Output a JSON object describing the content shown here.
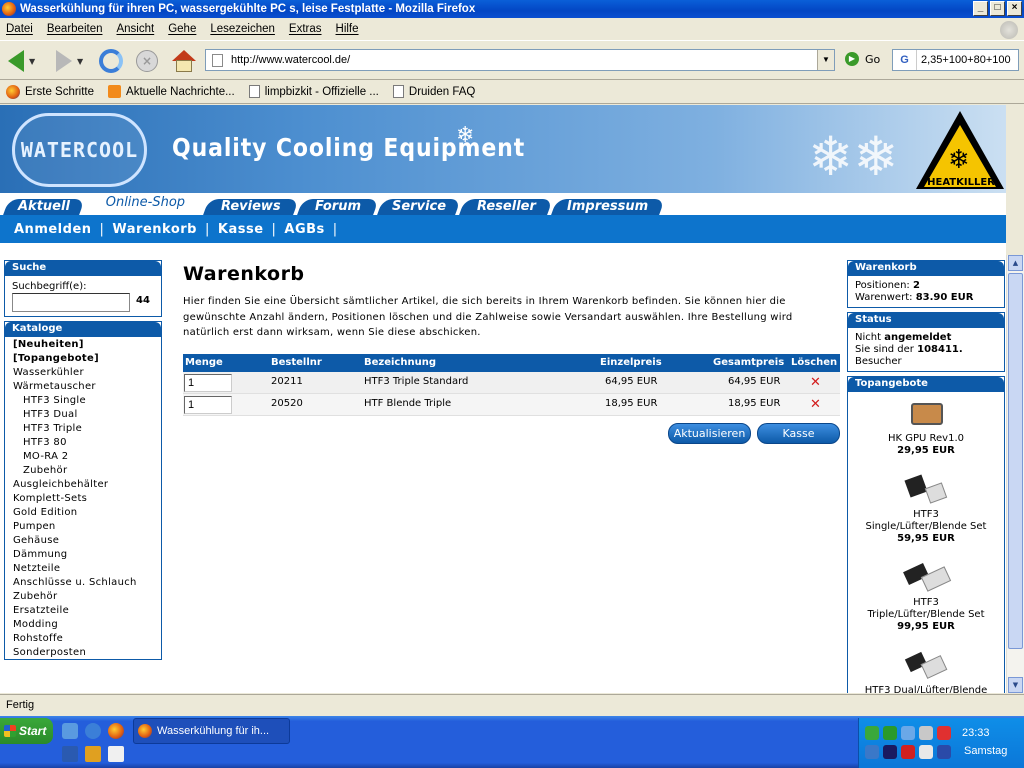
{
  "window": {
    "title": "Wasserkühlung für ihren PC, wassergekühlte PC s, leise Festplatte - Mozilla Firefox"
  },
  "menu": [
    "Datei",
    "Bearbeiten",
    "Ansicht",
    "Gehe",
    "Lesezeichen",
    "Extras",
    "Hilfe"
  ],
  "nav": {
    "url": "http://www.watercool.de/",
    "go_label": "Go",
    "search_value": "2,35+100+80+100"
  },
  "bookmarks": [
    "Erste Schritte",
    "Aktuelle Nachrichte...",
    "limpbizkit - Offizielle ...",
    "Druiden FAQ"
  ],
  "site": {
    "logo_text": "WATERCOOL",
    "tagline": "Quality Cooling Equipment",
    "heatkiller_text": "HEATKILLER",
    "tabs": [
      "Aktuell",
      "Online-Shop",
      "Reviews",
      "Forum",
      "Service",
      "Reseller",
      "Impressum"
    ],
    "active_tab": "Online-Shop",
    "subnav": [
      "Anmelden",
      "Warenkorb",
      "Kasse",
      "AGBs"
    ],
    "sep": "|"
  },
  "search_box": {
    "title": "Suche",
    "label": "Suchbegriff(e):",
    "value": "",
    "button": "44"
  },
  "catalog": {
    "title": "Kataloge",
    "items": [
      {
        "label": "[Neuheiten]",
        "level": "bold"
      },
      {
        "label": "[Topangebote]",
        "level": "bold"
      },
      {
        "label": "Wasserkühler",
        "level": "top"
      },
      {
        "label": "Wärmetauscher",
        "level": "top"
      },
      {
        "label": "HTF3 Single",
        "level": "sub"
      },
      {
        "label": "HTF3 Dual",
        "level": "sub"
      },
      {
        "label": "HTF3 Triple",
        "level": "sub"
      },
      {
        "label": "HTF3 80",
        "level": "sub"
      },
      {
        "label": "MO-RA 2",
        "level": "sub"
      },
      {
        "label": "Zubehör",
        "level": "sub"
      },
      {
        "label": "Ausgleichbehälter",
        "level": "top"
      },
      {
        "label": "Komplett-Sets",
        "level": "top"
      },
      {
        "label": "Gold Edition",
        "level": "top"
      },
      {
        "label": "Pumpen",
        "level": "top"
      },
      {
        "label": "Gehäuse",
        "level": "top"
      },
      {
        "label": "Dämmung",
        "level": "top"
      },
      {
        "label": "Netzteile",
        "level": "top"
      },
      {
        "label": "Anschlüsse u. Schlauch",
        "level": "top"
      },
      {
        "label": "Zubehör",
        "level": "top"
      },
      {
        "label": "Ersatzteile",
        "level": "top"
      },
      {
        "label": "Modding",
        "level": "top"
      },
      {
        "label": "Rohstoffe",
        "level": "top"
      },
      {
        "label": "Sonderposten",
        "level": "top"
      }
    ]
  },
  "cart": {
    "title": "Warenkorb",
    "intro": "Hier finden Sie eine Übersicht sämtlicher Artikel, die sich bereits in Ihrem Warenkorb befinden. Sie können hier die gewünschte Anzahl ändern, Positionen löschen und die Zahlweise sowie Versandart auswählen. Ihre Bestellung wird natürlich erst dann wirksam, wenn Sie diese abschicken.",
    "columns": [
      "Menge",
      "Bestellnr",
      "Bezeichnung",
      "Einzelpreis",
      "Gesamtpreis",
      "Löschen"
    ],
    "rows": [
      {
        "qty": "1",
        "nr": "20211",
        "name": "HTF3 Triple Standard",
        "unit": "64,95 EUR",
        "total": "64,95 EUR"
      },
      {
        "qty": "1",
        "nr": "20520",
        "name": "HTF Blende Triple",
        "unit": "18,95 EUR",
        "total": "18,95 EUR"
      }
    ],
    "update_label": "Aktualisieren",
    "checkout_label": "Kasse"
  },
  "right": {
    "wk_title": "Warenkorb",
    "positions_label": "Positionen:",
    "positions_value": "2",
    "value_label": "Warenwert:",
    "value_value": "83.90 EUR",
    "status_title": "Status",
    "status_line1_a": "Nicht",
    "status_line1_b": "angemeldet",
    "status_line2_a": "Sie sind der",
    "status_line2_b": "108411.",
    "status_line3": "Besucher",
    "top_title": "Topangebote",
    "products": [
      {
        "name": "HK GPU Rev1.0",
        "price": "29,95 EUR"
      },
      {
        "name": "HTF3\nSingle/Lüfter/Blende Set",
        "price": "59,95 EUR"
      },
      {
        "name": "HTF3\nTriple/Lüfter/Blende Set",
        "price": "99,95 EUR"
      },
      {
        "name": "HTF3 Dual/Lüfter/Blende",
        "price": ""
      }
    ]
  },
  "statusbar": "Fertig",
  "taskbar": {
    "start": "Start",
    "task": "Wasserkühlung für ih...",
    "clock": "23:33",
    "day": "Samstag"
  }
}
